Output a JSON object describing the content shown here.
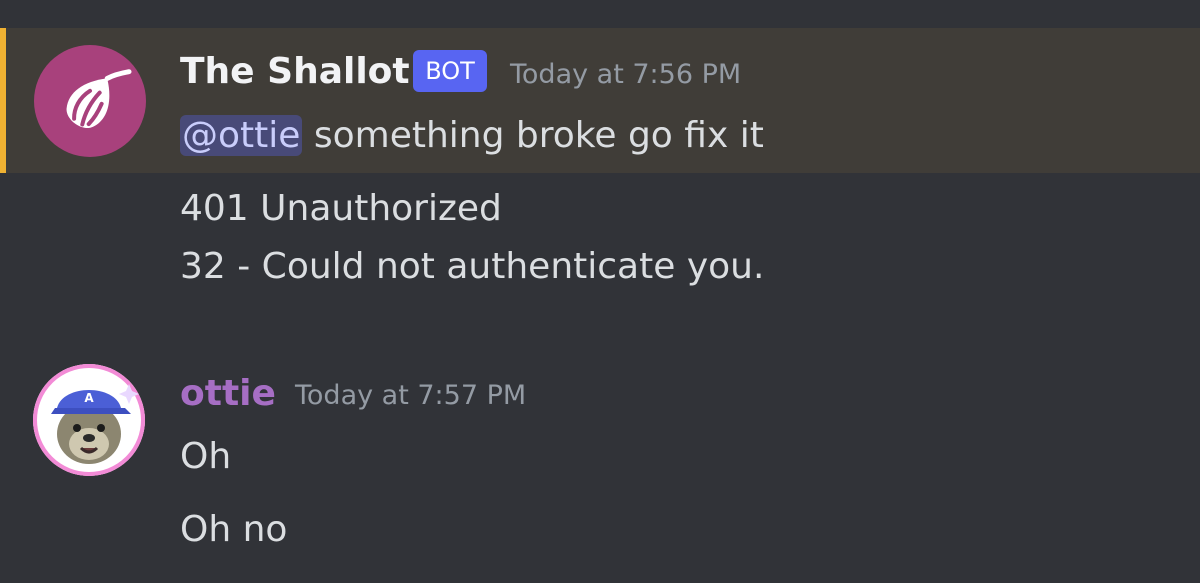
{
  "messages": [
    {
      "author": "The Shallot",
      "bot_tag": "BOT",
      "timestamp": "Today at 7:56 PM",
      "mention": "@ottie",
      "text": "something broke go fix it",
      "followups": [
        "401 Unauthorized",
        "32 - Could not authenticate you."
      ],
      "avatar_icon": "onion-icon",
      "avatar_color": "#a8417c",
      "highlighted": true
    },
    {
      "author": "ottie",
      "timestamp": "Today at 7:57 PM",
      "lines": [
        "Oh",
        "Oh no"
      ],
      "avatar_icon": "otter-avatar",
      "name_color": "#a66ec4"
    }
  ],
  "colors": {
    "background": "#313338",
    "highlight_background": "#403d38",
    "highlight_bar": "#f0b232",
    "bot_tag": "#5865f2",
    "mention_text": "#c9cdfb"
  }
}
